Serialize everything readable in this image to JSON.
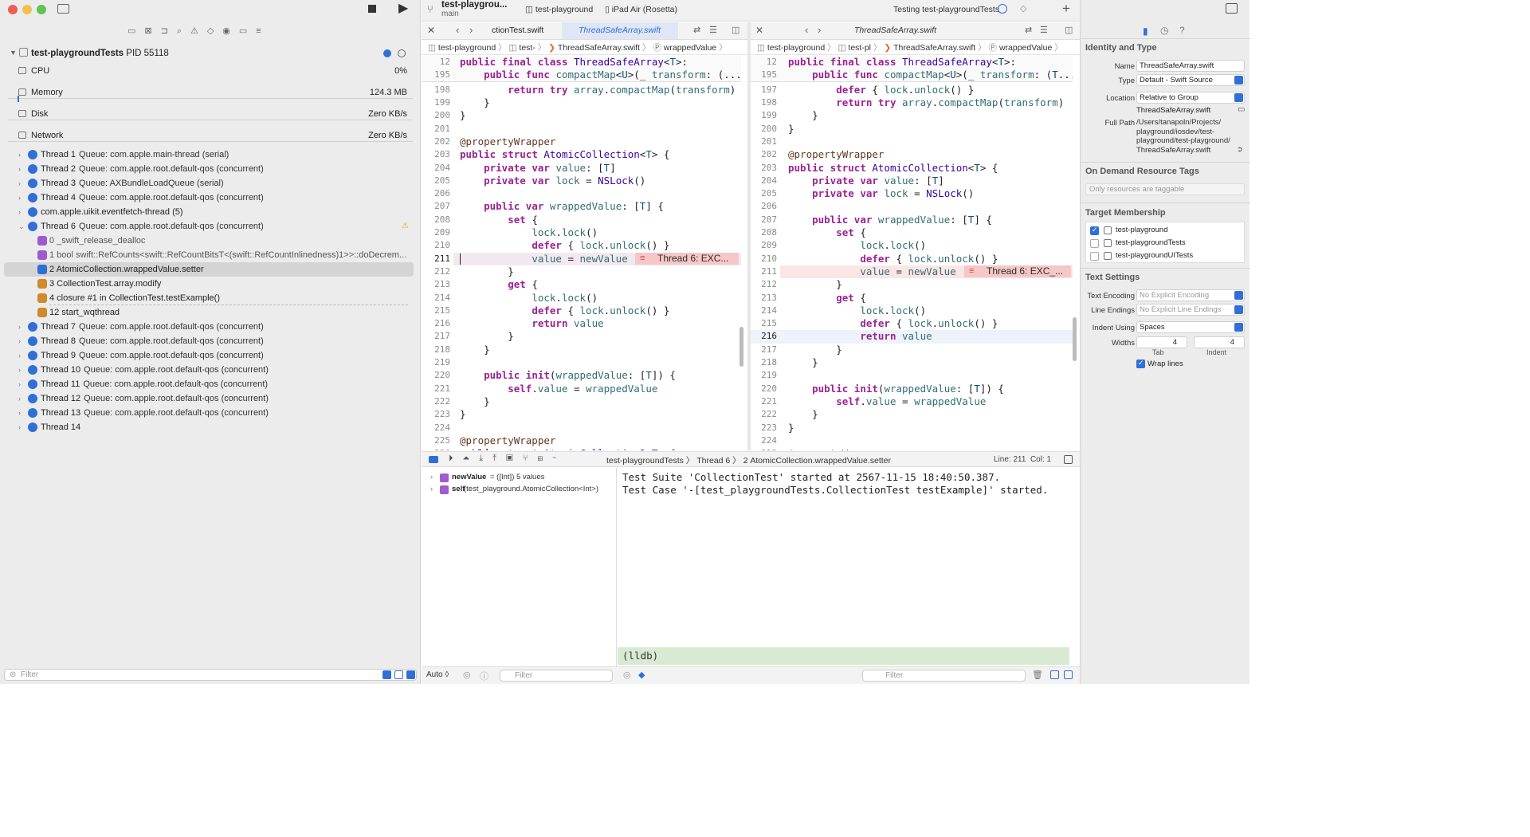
{
  "toolbar": {
    "project": "test-playgrou...",
    "branch": "main",
    "scheme": "test-playground",
    "device": "iPad Air (Rosetta)",
    "status": "Testing test-playgroundTests"
  },
  "debug_nav": {
    "process": "test-playgroundTests",
    "pid": "PID 55118",
    "gauges": [
      {
        "name": "CPU",
        "value": "0%"
      },
      {
        "name": "Memory",
        "value": "124.3 MB"
      },
      {
        "name": "Disk",
        "value": "Zero KB/s"
      },
      {
        "name": "Network",
        "value": "Zero KB/s"
      }
    ],
    "threads_before": [
      {
        "name": "Thread 1",
        "queue": "Queue: com.apple.main-thread (serial)"
      },
      {
        "name": "Thread 2",
        "queue": "Queue: com.apple.root.default-qos (concurrent)"
      },
      {
        "name": "Thread 3",
        "queue": "Queue: AXBundleLoadQueue (serial)"
      },
      {
        "name": "Thread 4",
        "queue": "Queue: com.apple.root.default-qos (concurrent)"
      },
      {
        "name": "com.apple.uikit.eventfetch-thread (5)",
        "queue": ""
      },
      {
        "name": "Thread 6",
        "queue": "Queue: com.apple.root.default-qos (concurrent)"
      }
    ],
    "frames": [
      "0 _swift_release_dealloc",
      "1 bool swift::RefCounts<swift::RefCountBitsT<(swift::RefCountInlinedness)1>>::doDecrem...",
      "2 AtomicCollection.wrappedValue.setter",
      "3 CollectionTest.array.modify",
      "4 closure #1 in CollectionTest.testExample()",
      "12 start_wqthread"
    ],
    "threads_after": [
      {
        "name": "Thread 7",
        "queue": "Queue: com.apple.root.default-qos (concurrent)"
      },
      {
        "name": "Thread 8",
        "queue": "Queue: com.apple.root.default-qos (concurrent)"
      },
      {
        "name": "Thread 9",
        "queue": "Queue: com.apple.root.default-qos (concurrent)"
      },
      {
        "name": "Thread 10",
        "queue": "Queue: com.apple.root.default-qos (concurrent)"
      },
      {
        "name": "Thread 11",
        "queue": "Queue: com.apple.root.default-qos (concurrent)"
      },
      {
        "name": "Thread 12",
        "queue": "Queue: com.apple.root.default-qos (concurrent)"
      },
      {
        "name": "Thread 13",
        "queue": "Queue: com.apple.root.default-qos (concurrent)"
      },
      {
        "name": "Thread 14",
        "queue": ""
      }
    ],
    "filter_placeholder": "Filter"
  },
  "editor_left": {
    "tabs": [
      "ctionTest.swift",
      "ThreadSafeArray.swift"
    ],
    "jump": [
      "test-playground",
      "test-",
      "ThreadSafeArray.swift",
      "wrappedValue"
    ],
    "sticky": [
      {
        "n": "12",
        "code": "public final class ThreadSafeArray<T>:"
      },
      {
        "n": "195",
        "code": "    public func compactMap<U>(_ transform: (..."
      }
    ],
    "error": "Thread 6: EXC..."
  },
  "editor_right": {
    "tabs": [
      "ThreadSafeArray.swift"
    ],
    "jump": [
      "test-playground",
      "test-pl",
      "ThreadSafeArray.swift",
      "wrappedValue"
    ],
    "sticky": [
      {
        "n": "12",
        "code": "public final class ThreadSafeArray<T>:"
      },
      {
        "n": "195",
        "code": "    public func compactMap<U>(_ transform: (T..."
      }
    ],
    "error": "Thread 6: EXC_..."
  },
  "code_lines": [
    {
      "n": "197",
      "code": "        defer { lock.unlock() }"
    },
    {
      "n": "198",
      "code": "        return try array.compactMap(transform)"
    },
    {
      "n": "199",
      "code": "    }"
    },
    {
      "n": "200",
      "code": "}"
    },
    {
      "n": "201",
      "code": ""
    },
    {
      "n": "202",
      "code": "@propertyWrapper"
    },
    {
      "n": "203",
      "code": "public struct AtomicCollection<T> {"
    },
    {
      "n": "204",
      "code": "    private var value: [T]"
    },
    {
      "n": "205",
      "code": "    private var lock = NSLock()"
    },
    {
      "n": "206",
      "code": ""
    },
    {
      "n": "207",
      "code": "    public var wrappedValue: [T] {"
    },
    {
      "n": "208",
      "code": "        set {"
    },
    {
      "n": "209",
      "code": "            lock.lock()"
    },
    {
      "n": "210",
      "code": "            defer { lock.unlock() }"
    },
    {
      "n": "211",
      "code": "            value = newValue"
    },
    {
      "n": "212",
      "code": "        }"
    },
    {
      "n": "213",
      "code": "        get {"
    },
    {
      "n": "214",
      "code": "            lock.lock()"
    },
    {
      "n": "215",
      "code": "            defer { lock.unlock() }"
    },
    {
      "n": "216",
      "code": "            return value"
    },
    {
      "n": "217",
      "code": "        }"
    },
    {
      "n": "218",
      "code": "    }"
    },
    {
      "n": "219",
      "code": ""
    },
    {
      "n": "220",
      "code": "    public init(wrappedValue: [T]) {"
    },
    {
      "n": "221",
      "code": "        self.value = wrappedValue"
    },
    {
      "n": "222",
      "code": "    }"
    },
    {
      "n": "223",
      "code": "}"
    },
    {
      "n": "224",
      "code": ""
    },
    {
      "n": "225",
      "code": "@propertyWrapper"
    },
    {
      "n": "226",
      "code": "public struct AtomicCollection2<T> {"
    }
  ],
  "debug_bar": {
    "crumbs": [
      "test-playgroundTests",
      "Thread 6",
      "2 AtomicCollection.wrappedValue.setter"
    ],
    "position": "Line: 211  Col: 1"
  },
  "variables": [
    {
      "name": "newValue",
      "detail": "= ([Int]) 5 values"
    },
    {
      "name": "self",
      "detail": "(test_playground.AtomicCollection<Int>)"
    }
  ],
  "console": {
    "lines": [
      "Test Suite 'CollectionTest' started at 2567-11-15 18:40:50.387.",
      "Test Case '-[test_playgroundTests.CollectionTest testExample]' started."
    ],
    "prompt": "(lldb)"
  },
  "bottom": {
    "auto": "Auto ◊",
    "filter_placeholder": "Filter"
  },
  "inspector": {
    "identity_title": "Identity and Type",
    "name_label": "Name",
    "name_value": "ThreadSafeArray.swift",
    "type_label": "Type",
    "type_value": "Default - Swift Source",
    "location_label": "Location",
    "location_value": "Relative to Group",
    "location_file": "ThreadSafeArray.swift",
    "full_path_label": "Full Path",
    "full_path": [
      "/Users/tanapoln/Projects/",
      "playground/iosdev/test-",
      "playground/test-playground/",
      "ThreadSafeArray.swift"
    ],
    "odr_title": "On Demand Resource Tags",
    "odr_placeholder": "Only resources are taggable",
    "target_title": "Target Membership",
    "targets": [
      {
        "name": "test-playground",
        "checked": true
      },
      {
        "name": "test-playgroundTests",
        "checked": false
      },
      {
        "name": "test-playgroundUITests",
        "checked": false
      }
    ],
    "text_title": "Text Settings",
    "encoding_label": "Text Encoding",
    "encoding_value": "No Explicit Encoding",
    "endings_label": "Line Endings",
    "endings_value": "No Explicit Line Endings",
    "indent_label": "Indent Using",
    "indent_value": "Spaces",
    "widths_label": "Widths",
    "tab_value": "4",
    "indent_value_n": "4",
    "tab_label": "Tab",
    "indent_label2": "Indent",
    "wrap_label": "Wrap lines"
  },
  "colors": {
    "accent": "#2f6fd6",
    "error": "#f6c7c7",
    "keyword": "#9b2393",
    "type": "#3900a0"
  }
}
